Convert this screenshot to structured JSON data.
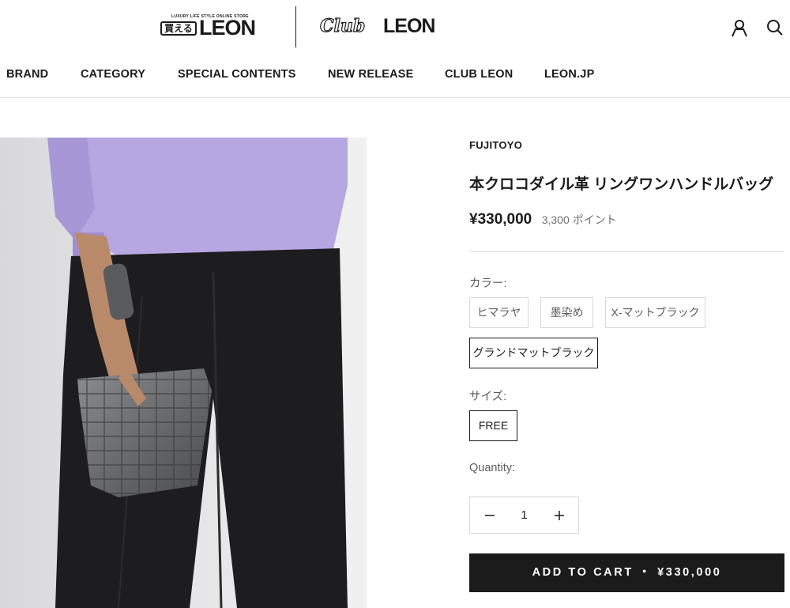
{
  "header": {
    "logo_tagline": "LUXURY LIFE STYLE ONLINE STORE",
    "logo_box_text": "買える",
    "logo_main": "LEON",
    "club_script": "Club",
    "club_leon": "LEON",
    "icons": [
      "account-icon",
      "search-icon"
    ]
  },
  "nav": {
    "items": [
      "BRAND",
      "CATEGORY",
      "SPECIAL CONTENTS",
      "NEW RELEASE",
      "CLUB LEON",
      "LEON.JP"
    ]
  },
  "product": {
    "brand": "FUJITOYO",
    "title": "本クロコダイル革 リングワンハンドルバッグ",
    "price": "¥330,000",
    "points": "3,300 ポイント",
    "color_label": "カラー:",
    "colors": [
      "ヒマラヤ",
      "墨染め",
      "X-マットブラック",
      "グランドマットブラック"
    ],
    "selected_color": "グランドマットブラック",
    "size_label": "サイズ:",
    "sizes": [
      "FREE"
    ],
    "selected_size": "FREE",
    "quantity_label": "Quantity:",
    "quantity": "1",
    "add_to_cart": "ADD TO CART ・ ¥330,000"
  },
  "colors": {
    "text": "#1c1b1b",
    "muted": "#5c5c5c",
    "border": "#d8d8d8",
    "button_bg": "#1c1b1b",
    "button_text": "#ffffff"
  }
}
